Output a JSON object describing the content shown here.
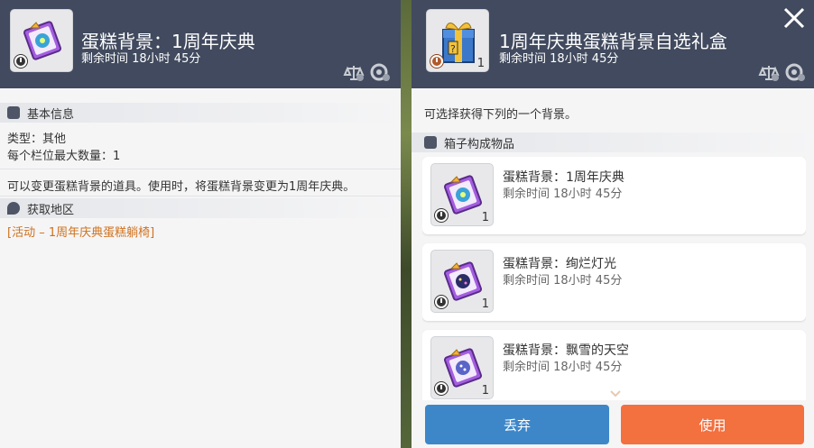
{
  "left_panel": {
    "title": "蛋糕背景：1周年庆典",
    "remaining": "剩余时间 18小时 45分",
    "basic_info": {
      "heading": "基本信息",
      "type_line": "类型：其他",
      "max_stack_line": "每个栏位最大数量：1"
    },
    "description": "可以变更蛋糕背景的道具。使用时，将蛋糕背景变更为1周年庆典。",
    "source": {
      "heading": "获取地区",
      "link": "[活动 – 1周年庆典蛋糕躺椅]"
    }
  },
  "right_panel": {
    "title": "1周年庆典蛋糕背景自选礼盒",
    "remaining": "剩余时间 18小时 45分",
    "quantity": "1",
    "instruction": "可选择获得下列的一个背景。",
    "contents_heading": "箱子构成物品",
    "items": [
      {
        "name": "蛋糕背景：1周年庆典",
        "remaining": "剩余时间 18小时 45分",
        "quantity": "1",
        "icon": "cake-bg-anniversary-icon"
      },
      {
        "name": "蛋糕背景：绚烂灯光",
        "remaining": "剩余时间 18小时 45分",
        "quantity": "1",
        "icon": "cake-bg-lights-icon"
      },
      {
        "name": "蛋糕背景：飘雪的天空",
        "remaining": "剩余时间 18小时 45分",
        "quantity": "1",
        "icon": "cake-bg-snow-icon"
      }
    ],
    "buttons": {
      "discard": "丢弃",
      "use": "使用"
    }
  },
  "colors": {
    "header_bg": "#414a5e",
    "panel_bg": "#f5f5f6",
    "discard_btn": "#3d87c9",
    "use_btn": "#f3703f",
    "source_link": "#d0711c"
  }
}
